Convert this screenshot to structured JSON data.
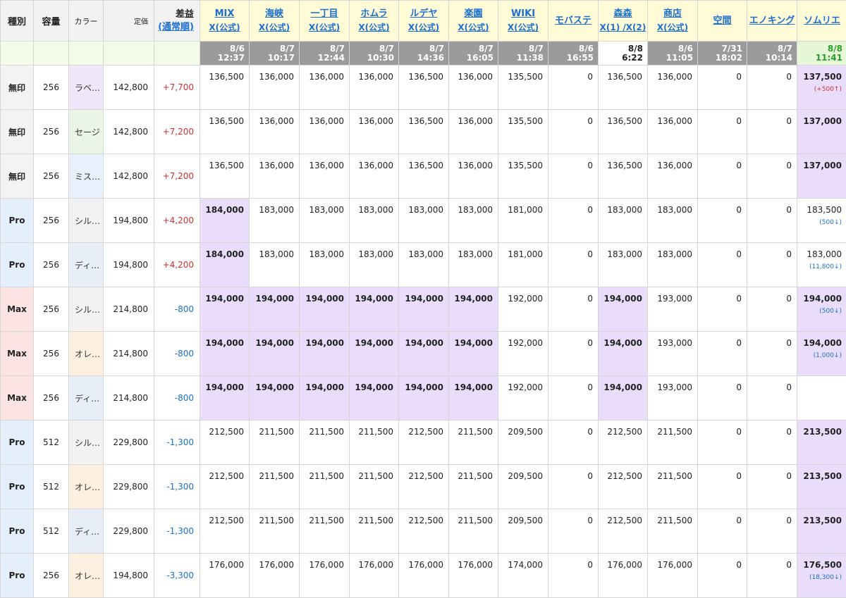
{
  "header": {
    "kind": "種別",
    "capacity": "容量",
    "color": "カラー",
    "price": "定価",
    "diff": "差益",
    "diff_sub": "(通常順)"
  },
  "shops": [
    {
      "l1": "MIX",
      "l2": "X(公式)"
    },
    {
      "l1": "海峡",
      "l2": "X(公式)"
    },
    {
      "l1": "一丁目",
      "l2": "X(公式)"
    },
    {
      "l1": "ホムラ",
      "l2": "X(公式)"
    },
    {
      "l1": "ルデヤ",
      "l2": "X(公式)"
    },
    {
      "l1": "楽園",
      "l2": "X(公式)"
    },
    {
      "l1": "WIKI",
      "l2": "X(公式)"
    },
    {
      "l1": "モバステ",
      "l2": ""
    },
    {
      "l1": "森森",
      "l2": "X(1) /X(2)"
    },
    {
      "l1": "商店",
      "l2": "X(公式)"
    },
    {
      "l1": "空間",
      "l2": ""
    },
    {
      "l1": "エノキング",
      "l2": ""
    },
    {
      "l1": "ソムリエ",
      "l2": ""
    }
  ],
  "timestamps": [
    {
      "d": "8/6",
      "t": "12:37"
    },
    {
      "d": "8/7",
      "t": "10:17"
    },
    {
      "d": "8/7",
      "t": "12:44"
    },
    {
      "d": "8/7",
      "t": "10:30"
    },
    {
      "d": "8/7",
      "t": "14:36"
    },
    {
      "d": "8/7",
      "t": "16:05"
    },
    {
      "d": "8/7",
      "t": "11:38"
    },
    {
      "d": "8/6",
      "t": "16:55"
    },
    {
      "d": "8/8",
      "t": "6:22"
    },
    {
      "d": "8/6",
      "t": "11:05"
    },
    {
      "d": "7/31",
      "t": "18:02"
    },
    {
      "d": "8/7",
      "t": "10:14"
    },
    {
      "d": "8/8",
      "t": "11:41"
    }
  ],
  "rows": [
    {
      "kind": "無印",
      "cap": "256",
      "color": "ラベ…",
      "price": "142,800",
      "diff": "+7,700",
      "values": [
        "136,500",
        "136,000",
        "136,000",
        "136,000",
        "136,500",
        "136,000",
        "135,500",
        "0",
        "136,500",
        "136,000",
        "0",
        "0",
        "137,500"
      ],
      "hl": [
        12
      ],
      "note": "(+500↑)"
    },
    {
      "kind": "無印",
      "cap": "256",
      "color": "セージ",
      "price": "142,800",
      "diff": "+7,200",
      "values": [
        "136,500",
        "136,000",
        "136,000",
        "136,000",
        "136,500",
        "136,000",
        "135,500",
        "0",
        "136,500",
        "136,000",
        "0",
        "0",
        "137,000"
      ],
      "hl": [
        12
      ],
      "note": ""
    },
    {
      "kind": "無印",
      "cap": "256",
      "color": "ミス…",
      "price": "142,800",
      "diff": "+7,200",
      "values": [
        "136,500",
        "136,000",
        "136,000",
        "136,000",
        "136,500",
        "136,000",
        "135,500",
        "0",
        "136,500",
        "136,000",
        "0",
        "0",
        "137,000"
      ],
      "hl": [
        12
      ],
      "note": ""
    },
    {
      "kind": "Pro",
      "cap": "256",
      "color": "シル…",
      "price": "194,800",
      "diff": "+4,200",
      "values": [
        "184,000",
        "183,000",
        "183,000",
        "183,000",
        "183,000",
        "183,000",
        "181,000",
        "0",
        "183,000",
        "183,000",
        "0",
        "0",
        "183,500"
      ],
      "hl": [
        0
      ],
      "note": "(500↓)"
    },
    {
      "kind": "Pro",
      "cap": "256",
      "color": "ディ…",
      "price": "194,800",
      "diff": "+4,200",
      "values": [
        "184,000",
        "183,000",
        "183,000",
        "183,000",
        "183,000",
        "183,000",
        "181,000",
        "0",
        "183,000",
        "183,000",
        "0",
        "0",
        "183,000"
      ],
      "hl": [
        0
      ],
      "note": "(11,800↓)"
    },
    {
      "kind": "Max",
      "cap": "256",
      "color": "シル…",
      "price": "214,800",
      "diff": "-800",
      "values": [
        "194,000",
        "194,000",
        "194,000",
        "194,000",
        "194,000",
        "194,000",
        "192,000",
        "0",
        "194,000",
        "193,000",
        "0",
        "0",
        "194,000"
      ],
      "hl": [
        0,
        1,
        2,
        3,
        4,
        5,
        8,
        12
      ],
      "note": "(500↓)"
    },
    {
      "kind": "Max",
      "cap": "256",
      "color": "オレ…",
      "price": "214,800",
      "diff": "-800",
      "values": [
        "194,000",
        "194,000",
        "194,000",
        "194,000",
        "194,000",
        "194,000",
        "192,000",
        "0",
        "194,000",
        "193,000",
        "0",
        "0",
        "194,000"
      ],
      "hl": [
        0,
        1,
        2,
        3,
        4,
        5,
        8,
        12
      ],
      "note": "(1,000↓)"
    },
    {
      "kind": "Max",
      "cap": "256",
      "color": "ディ…",
      "price": "214,800",
      "diff": "-800",
      "values": [
        "194,000",
        "194,000",
        "194,000",
        "194,000",
        "194,000",
        "194,000",
        "192,000",
        "0",
        "194,000",
        "193,000",
        "0",
        "0",
        ""
      ],
      "hl": [
        0,
        1,
        2,
        3,
        4,
        5,
        8
      ],
      "note": ""
    },
    {
      "kind": "Pro",
      "cap": "512",
      "color": "シル…",
      "price": "229,800",
      "diff": "-1,300",
      "values": [
        "212,500",
        "211,500",
        "211,500",
        "211,500",
        "212,500",
        "211,500",
        "209,500",
        "0",
        "212,500",
        "211,500",
        "0",
        "0",
        "213,500"
      ],
      "hl": [
        12
      ],
      "note": ""
    },
    {
      "kind": "Pro",
      "cap": "512",
      "color": "オレ…",
      "price": "229,800",
      "diff": "-1,300",
      "values": [
        "212,500",
        "211,500",
        "211,500",
        "211,500",
        "212,500",
        "211,500",
        "209,500",
        "0",
        "212,500",
        "211,500",
        "0",
        "0",
        "213,500"
      ],
      "hl": [
        12
      ],
      "note": ""
    },
    {
      "kind": "Pro",
      "cap": "512",
      "color": "ディ…",
      "price": "229,800",
      "diff": "-1,300",
      "values": [
        "212,500",
        "211,500",
        "211,500",
        "211,500",
        "212,500",
        "211,500",
        "209,500",
        "0",
        "212,500",
        "211,500",
        "0",
        "0",
        "213,500"
      ],
      "hl": [
        12
      ],
      "note": ""
    },
    {
      "kind": "Pro",
      "cap": "256",
      "color": "オレ…",
      "price": "194,800",
      "diff": "-3,300",
      "values": [
        "176,000",
        "176,000",
        "176,000",
        "176,000",
        "176,000",
        "176,000",
        "174,000",
        "0",
        "176,000",
        "176,000",
        "0",
        "0",
        "176,500"
      ],
      "hl": [
        12
      ],
      "note": "(18,300↓)"
    }
  ],
  "colors": {
    "kind_bg": {
      "無印": "#f3f3f3",
      "Pro": "#e5eefb",
      "Max": "#fde4e4"
    },
    "color_bg": {
      "ラベ…": "#f0e6fa",
      "セージ": "#eaf5e6",
      "ミス…": "#e7f1fb",
      "シル…": "#f2f2f2",
      "ディ…": "#e8eef7",
      "オレ…": "#fdf0e0"
    },
    "highlight": "#eadcfb",
    "header_shop_bg": "#fffbd6",
    "timestamp_bg": "#9b9b9b",
    "link": "#1a6fd0",
    "positive": "#d13232"
  }
}
